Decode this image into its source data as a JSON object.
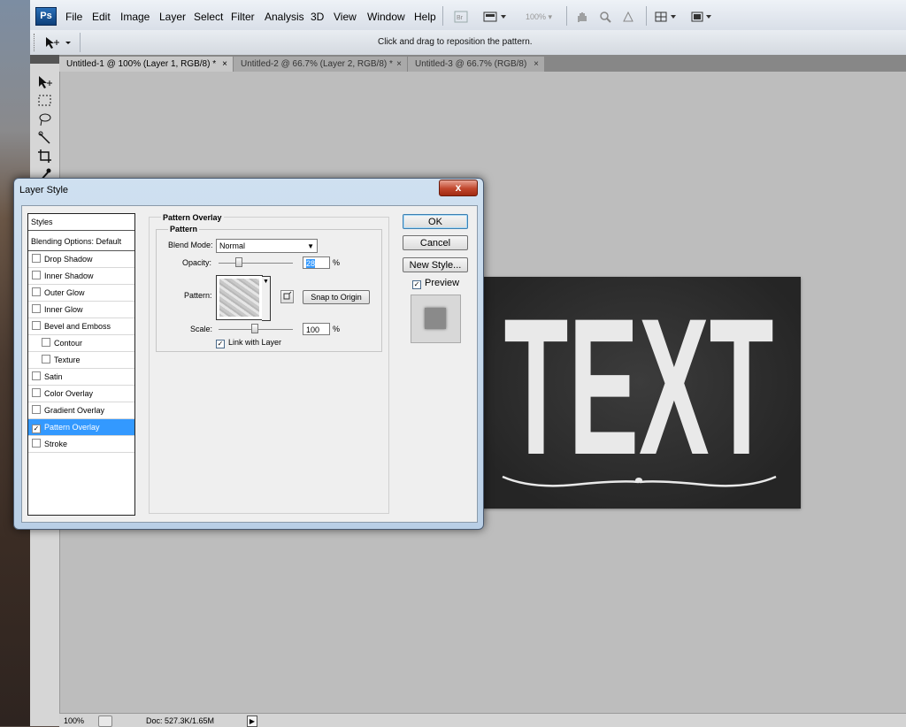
{
  "app": {
    "logo": "Ps"
  },
  "menu": {
    "items": [
      "File",
      "Edit",
      "Image",
      "Layer",
      "Select",
      "Filter",
      "Analysis",
      "3D",
      "View",
      "Window",
      "Help"
    ],
    "zoom": "100%"
  },
  "options": {
    "hint": "Click and drag to reposition the pattern."
  },
  "tabs": [
    {
      "label": "Untitled-1 @ 100% (Layer 1, RGB/8) *",
      "close": "×"
    },
    {
      "label": "Untitled-2 @ 66.7% (Layer 2, RGB/8) *",
      "close": "×"
    },
    {
      "label": "Untitled-3 @ 66.7% (RGB/8)",
      "close": "×"
    }
  ],
  "canvas": {
    "text": "TEXT"
  },
  "status": {
    "zoom": "100%",
    "doc": "Doc: 527.3K/1.65M"
  },
  "dialog": {
    "title": "Layer Style",
    "close": "x",
    "styles_header": "Styles",
    "blending": "Blending Options: Default",
    "styles": [
      {
        "label": "Drop Shadow",
        "checked": false
      },
      {
        "label": "Inner Shadow",
        "checked": false
      },
      {
        "label": "Outer Glow",
        "checked": false
      },
      {
        "label": "Inner Glow",
        "checked": false
      },
      {
        "label": "Bevel and Emboss",
        "checked": false
      },
      {
        "label": "Contour",
        "checked": false
      },
      {
        "label": "Texture",
        "checked": false
      },
      {
        "label": "Satin",
        "checked": false
      },
      {
        "label": "Color Overlay",
        "checked": false
      },
      {
        "label": "Gradient Overlay",
        "checked": false
      },
      {
        "label": "Pattern Overlay",
        "checked": true
      },
      {
        "label": "Stroke",
        "checked": false
      }
    ],
    "section_title": "Pattern Overlay",
    "group_title": "Pattern",
    "blend_mode_label": "Blend Mode:",
    "blend_mode_value": "Normal",
    "opacity_label": "Opacity:",
    "opacity_value": "28",
    "opacity_unit": "%",
    "pattern_label": "Pattern:",
    "snap_button": "Snap to Origin",
    "scale_label": "Scale:",
    "scale_value": "100",
    "scale_unit": "%",
    "link_label": "Link with Layer",
    "ok": "OK",
    "cancel": "Cancel",
    "new_style": "New Style...",
    "preview": "Preview"
  }
}
